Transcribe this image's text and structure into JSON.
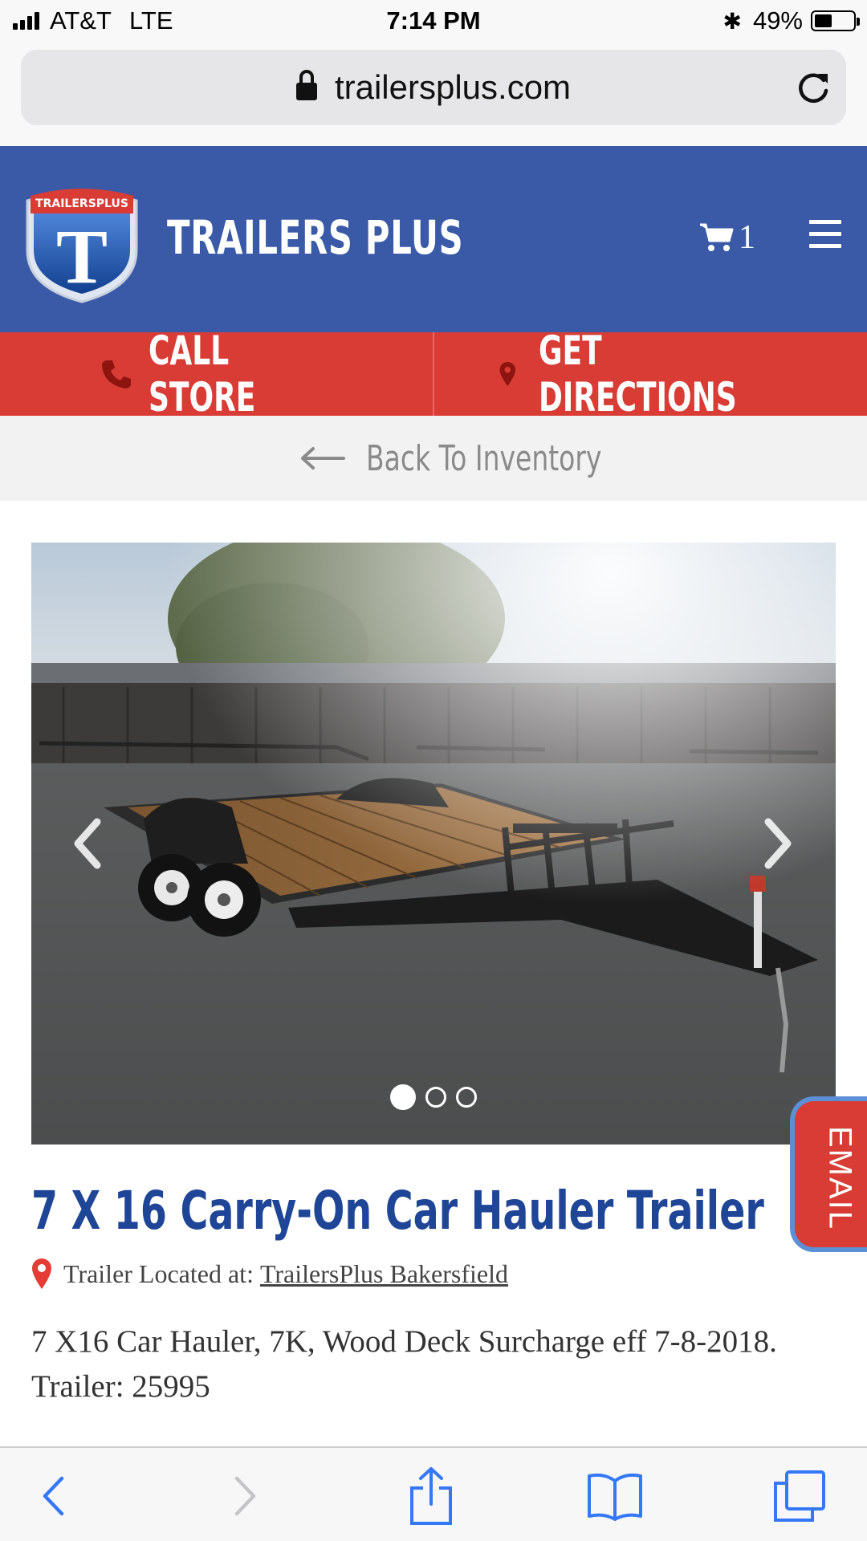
{
  "status_bar": {
    "carrier": "AT&T",
    "network": "LTE",
    "time": "7:14 PM",
    "battery": "49%",
    "battery_level": 0.49
  },
  "browser": {
    "url": "trailersplus.com"
  },
  "header": {
    "logo_text": "TRAILERSPLUS",
    "brand_name": "TRAILERS PLUS",
    "cart_count": "1"
  },
  "actions": {
    "call_store": "CALL STORE",
    "get_directions": "GET DIRECTIONS"
  },
  "back": {
    "label": "Back To Inventory"
  },
  "gallery": {
    "slide_count": 3,
    "active_slide": 1
  },
  "email_tab": {
    "label": "EMAIL"
  },
  "product": {
    "title": "7 X 16 Carry-On Car Hauler Trailer",
    "location_prefix": "Trailer Located at:",
    "location_name": "TrailersPlus Bakersfield",
    "description": "7 X16 Car Hauler, 7K, Wood Deck Surcharge eff 7-8-2018. Trailer: 25995"
  },
  "colors": {
    "header_blue": "#3a5aa8",
    "action_red": "#d93b35",
    "title_blue": "#1f4597",
    "ios_blue": "#3478f6"
  }
}
